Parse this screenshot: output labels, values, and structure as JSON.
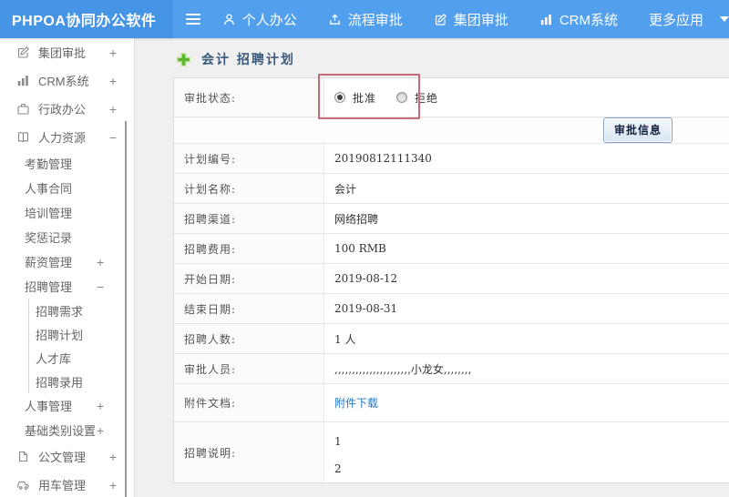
{
  "topbar": {
    "logo": "PHPOA协同办公软件",
    "nav": [
      {
        "label": "个人办公",
        "icon": "person-icon"
      },
      {
        "label": "流程审批",
        "icon": "workflow-icon"
      },
      {
        "label": "集团审批",
        "icon": "edit-square-icon"
      },
      {
        "label": "CRM系统",
        "icon": "bar-chart-icon"
      },
      {
        "label": "更多应用",
        "icon": "caret-down-icon"
      }
    ]
  },
  "sidebar": {
    "items": [
      {
        "label": "集团审批",
        "level": 1,
        "icon": "edit-square-icon",
        "expander": "+"
      },
      {
        "label": "CRM系统",
        "level": 1,
        "icon": "bar-chart-icon",
        "expander": "+"
      },
      {
        "label": "行政办公",
        "level": 1,
        "icon": "briefcase-icon",
        "expander": "+"
      },
      {
        "label": "人力资源",
        "level": 1,
        "icon": "book-icon",
        "expander": "−"
      },
      {
        "label": "考勤管理",
        "level": 2,
        "expander": ""
      },
      {
        "label": "人事合同",
        "level": 2,
        "expander": ""
      },
      {
        "label": "培训管理",
        "level": 2,
        "expander": ""
      },
      {
        "label": "奖惩记录",
        "level": 2,
        "expander": ""
      },
      {
        "label": "薪资管理",
        "level": 2,
        "expander": "+"
      },
      {
        "label": "招聘管理",
        "level": 2,
        "expander": "−"
      },
      {
        "label": "招聘需求",
        "level": 3,
        "expander": ""
      },
      {
        "label": "招聘计划",
        "level": 3,
        "expander": ""
      },
      {
        "label": "人才库",
        "level": 3,
        "expander": ""
      },
      {
        "label": "招聘录用",
        "level": 3,
        "expander": ""
      },
      {
        "label": "人事管理",
        "level": 2,
        "expander": "+"
      },
      {
        "label": "基础类别设置",
        "level": 2,
        "expander": "+"
      },
      {
        "label": "公文管理",
        "level": 1,
        "icon": "document-icon",
        "expander": "+"
      },
      {
        "label": "用车管理",
        "level": 1,
        "icon": "car-icon",
        "expander": "+"
      }
    ]
  },
  "main": {
    "title": "会计 招聘计划",
    "form": {
      "status_label": "审批状态:",
      "radio_approve": "批准",
      "radio_reject": "拒绝",
      "approve_button": "审批信息",
      "rows": [
        {
          "label": "计划编号:",
          "value": "20190812111340"
        },
        {
          "label": "计划名称:",
          "value": "会计"
        },
        {
          "label": "招聘渠道:",
          "value": "网络招聘"
        },
        {
          "label": "招聘费用:",
          "value": "100 RMB"
        },
        {
          "label": "开始日期:",
          "value": "2019-08-12"
        },
        {
          "label": "结束日期:",
          "value": "2019-08-31"
        },
        {
          "label": "招聘人数:",
          "value": "1 人"
        },
        {
          "label": "审批人员:",
          "value": ",,,,,,,,,,,,,,,,,,,,,,小龙女,,,,,,,,"
        },
        {
          "label": "附件文档:",
          "value": "附件下载"
        },
        {
          "label": "招聘说明:",
          "value": "1\n2"
        }
      ]
    }
  },
  "colors": {
    "topbar_blue": "#529fee",
    "logo_blue": "#4694e6",
    "link_blue": "#2176c7",
    "annotation_red": "#c96b76",
    "plus_green": "#5cb62c",
    "title_navy": "#3b5a7a"
  }
}
